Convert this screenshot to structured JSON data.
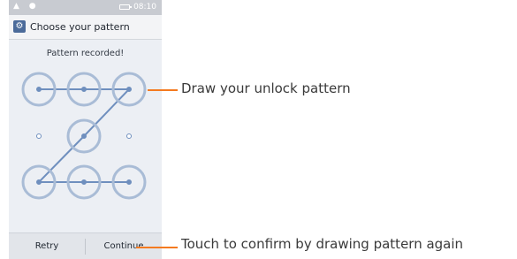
{
  "status_bar": {
    "left_icons": "▲ ●",
    "time": "08:10"
  },
  "app_bar": {
    "title": "Choose your pattern",
    "icon": "settings-gear-icon"
  },
  "pattern": {
    "message": "Pattern recorded!",
    "grid_size": 3,
    "sequence": [
      0,
      1,
      2,
      4,
      6,
      7,
      8
    ],
    "colors": {
      "ring": "#a9bcd6",
      "line": "#6f8fbe",
      "dot": "#6f8fbe"
    }
  },
  "buttons": {
    "retry_label": "Retry",
    "continue_label": "Continue"
  },
  "callouts": {
    "draw": "Draw your unlock pattern",
    "confirm": "Touch to confirm by drawing pattern again",
    "color": "#f47a20"
  }
}
